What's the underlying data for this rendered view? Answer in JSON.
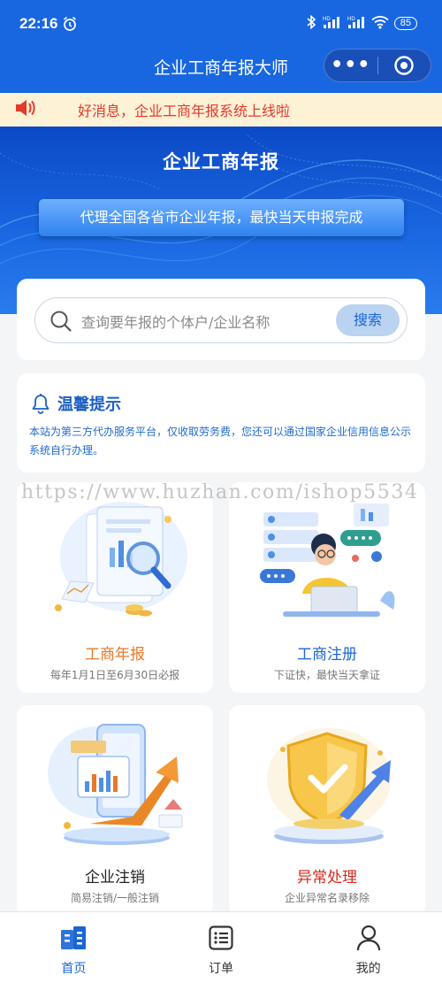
{
  "status_bar": {
    "time": "22:16",
    "battery": "85",
    "hd1": "HD",
    "hd2": "HD"
  },
  "nav": {
    "title": "企业工商年报大师",
    "more_icon": "more-dots-icon",
    "close_icon": "target-close-icon"
  },
  "notice": {
    "text": "好消息，企业工商年报系统上线啦"
  },
  "banner": {
    "title": "企业工商年报",
    "subtitle": "代理全国各省市企业年报，最快当天申报完成"
  },
  "search": {
    "placeholder": "查询要年报的个体户/企业名称",
    "button": "搜索"
  },
  "tips": {
    "title": "温馨提示",
    "body": "本站为第三方代办服务平台，仅收取劳务费，您还可以通过国家企业信用信息公示系统自行办理。"
  },
  "watermark": "https://www.huzhan.com/ishop5534",
  "services": [
    {
      "name": "工商年报",
      "desc": "每年1月1日至6月30日必报",
      "color": "#e8782a"
    },
    {
      "name": "工商注册",
      "desc": "下证快，最快当天拿证",
      "color": "#1a66d6"
    },
    {
      "name": "企业注销",
      "desc": "简易注销/一般注销",
      "color": "#222222"
    },
    {
      "name": "异常处理",
      "desc": "企业异常名录移除",
      "color": "#d8281e"
    }
  ],
  "tabbar": {
    "items": [
      {
        "label": "首页"
      },
      {
        "label": "订单"
      },
      {
        "label": "我的"
      }
    ]
  },
  "colors": {
    "primary": "#1867e0",
    "notice_bg": "#fdf1d6",
    "notice_text": "#e23a2c"
  }
}
